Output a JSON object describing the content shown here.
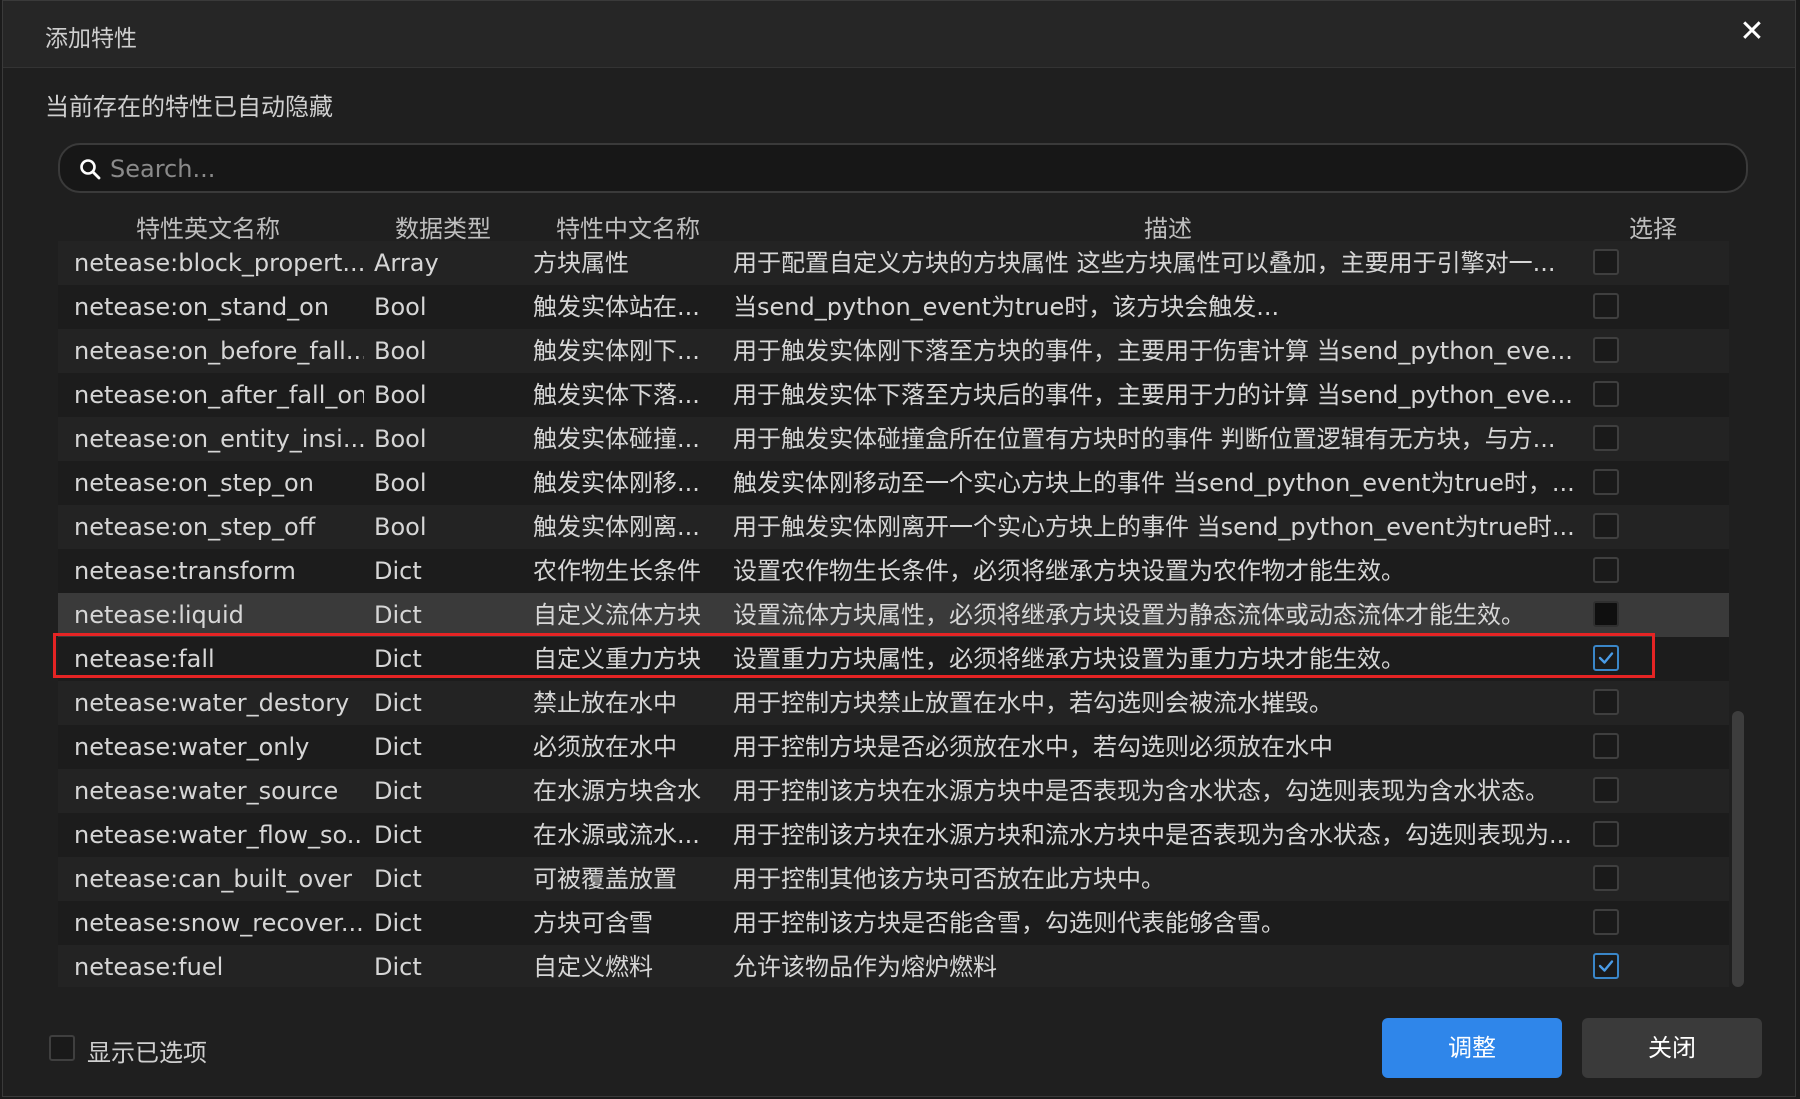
{
  "dialog": {
    "title": "添加特性",
    "hint": "当前存在的特性已自动隐藏",
    "close_icon": "close-icon"
  },
  "search": {
    "placeholder": "Search...",
    "value": ""
  },
  "table": {
    "headers": [
      "特性英文名称",
      "数据类型",
      "特性中文名称",
      "描述",
      "选择"
    ],
    "rows": [
      {
        "name": "netease:block_propert...",
        "type": "Array",
        "cn": "方块属性",
        "desc": "用于配置自定义方块的方块属性 这些方块属性可以叠加，主要用于引擎对一...",
        "checked": false
      },
      {
        "name": "netease:on_stand_on",
        "type": "Bool",
        "cn": "触发实体站在...",
        "desc": "当send_python_event为true时，该方块会触发...",
        "checked": false
      },
      {
        "name": "netease:on_before_fall...",
        "type": "Bool",
        "cn": "触发实体刚下...",
        "desc": "用于触发实体刚下落至方块的事件，主要用于伤害计算 当send_python_eve...",
        "checked": false
      },
      {
        "name": "netease:on_after_fall_on",
        "type": "Bool",
        "cn": "触发实体下落...",
        "desc": "用于触发实体下落至方块后的事件，主要用于力的计算 当send_python_eve...",
        "checked": false
      },
      {
        "name": "netease:on_entity_insi...",
        "type": "Bool",
        "cn": "触发实体碰撞...",
        "desc": "用于触发实体碰撞盒所在位置有方块时的事件 判断位置逻辑有无方块，与方...",
        "checked": false
      },
      {
        "name": "netease:on_step_on",
        "type": "Bool",
        "cn": "触发实体刚移...",
        "desc": "触发实体刚移动至一个实心方块上的事件 当send_python_event为true时，...",
        "checked": false
      },
      {
        "name": "netease:on_step_off",
        "type": "Bool",
        "cn": "触发实体刚离...",
        "desc": "用于触发实体刚离开一个实心方块上的事件 当send_python_event为true时...",
        "checked": false
      },
      {
        "name": "netease:transform",
        "type": "Dict",
        "cn": "农作物生长条件",
        "desc": "设置农作物生长条件，必须将继承方块设置为农作物才能生效。",
        "checked": false
      },
      {
        "name": "netease:liquid",
        "type": "Dict",
        "cn": "自定义流体方块",
        "desc": "设置流体方块属性，必须将继承方块设置为静态流体或动态流体才能生效。",
        "checked": false
      },
      {
        "name": "netease:fall",
        "type": "Dict",
        "cn": "自定义重力方块",
        "desc": "设置重力方块属性，必须将继承方块设置为重力方块才能生效。",
        "checked": true
      },
      {
        "name": "netease:water_destory",
        "type": "Dict",
        "cn": "禁止放在水中",
        "desc": "用于控制方块禁止放置在水中，若勾选则会被流水摧毁。",
        "checked": false
      },
      {
        "name": "netease:water_only",
        "type": "Dict",
        "cn": "必须放在水中",
        "desc": "用于控制方块是否必须放在水中，若勾选则必须放在水中",
        "checked": false
      },
      {
        "name": "netease:water_source",
        "type": "Dict",
        "cn": "在水源方块含水",
        "desc": "用于控制该方块在水源方块中是否表现为含水状态，勾选则表现为含水状态。",
        "checked": false
      },
      {
        "name": "netease:water_flow_so...",
        "type": "Dict",
        "cn": "在水源或流水...",
        "desc": "用于控制该方块在水源方块和流水方块中是否表现为含水状态，勾选则表现为...",
        "checked": false
      },
      {
        "name": "netease:can_built_over",
        "type": "Dict",
        "cn": "可被覆盖放置",
        "desc": "用于控制其他该方块可否放在此方块中。",
        "checked": false
      },
      {
        "name": "netease:snow_recover...",
        "type": "Dict",
        "cn": "方块可含雪",
        "desc": "用于控制该方块是否能含雪，勾选则代表能够含雪。",
        "checked": false
      },
      {
        "name": "netease:fuel",
        "type": "Dict",
        "cn": "自定义燃料",
        "desc": "允许该物品作为熔炉燃料",
        "checked": true
      }
    ]
  },
  "footer": {
    "show_selected_label": "显示已选项",
    "adjust_label": "调整",
    "close_label": "关闭"
  },
  "colors": {
    "accent": "#2f86ea",
    "highlight_border": "#e52424",
    "check": "#3a86c8"
  }
}
